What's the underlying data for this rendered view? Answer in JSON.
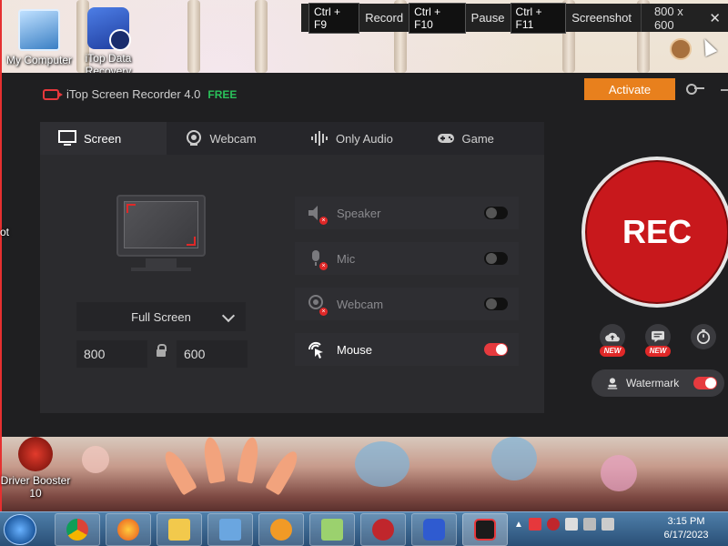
{
  "desktop": {
    "icons": [
      {
        "label": "My Computer"
      },
      {
        "label": "iTop Data Recovery"
      },
      {
        "label": "Driver Booster 10"
      }
    ],
    "clipped_texts": {
      "left_ot": "ot"
    }
  },
  "hotkey_bar": {
    "record_key": "Ctrl + F9",
    "record_label": "Record",
    "pause_key": "Ctrl + F10",
    "pause_label": "Pause",
    "screenshot_key": "Ctrl + F11",
    "screenshot_label": "Screenshot",
    "dimensions": "800 x 600",
    "close": "✕"
  },
  "app": {
    "title": "iTop Screen Recorder 4.0",
    "edition": "FREE",
    "activate_label": "Activate",
    "tabs": [
      {
        "label": "Screen",
        "icon": "monitor-icon",
        "active": true
      },
      {
        "label": "Webcam",
        "icon": "webcam-icon",
        "active": false
      },
      {
        "label": "Only Audio",
        "icon": "waveform-icon",
        "active": false
      },
      {
        "label": "Game",
        "icon": "gamepad-icon",
        "active": false
      }
    ],
    "capture_mode": "Full Screen",
    "width_value": "800",
    "height_value": "600",
    "options": [
      {
        "label": "Speaker",
        "icon": "speaker-icon",
        "enabled": false
      },
      {
        "label": "Mic",
        "icon": "mic-icon",
        "enabled": false
      },
      {
        "label": "Webcam",
        "icon": "webcam-icon",
        "enabled": false
      },
      {
        "label": "Mouse",
        "icon": "mouse-click-icon",
        "enabled": true
      }
    ],
    "rec_label": "REC",
    "tools": [
      {
        "icon": "cloud-upload-icon",
        "badge": "NEW"
      },
      {
        "icon": "chat-icon",
        "badge": "NEW"
      },
      {
        "icon": "timer-icon",
        "badge": ""
      }
    ],
    "watermark_label": "Watermark",
    "watermark_enabled": true,
    "accent_color": "#e63a3e",
    "activate_color": "#e8801d"
  },
  "taskbar": {
    "time": "3:15 PM",
    "date": "6/17/2023",
    "tray_arrow": "▲"
  }
}
